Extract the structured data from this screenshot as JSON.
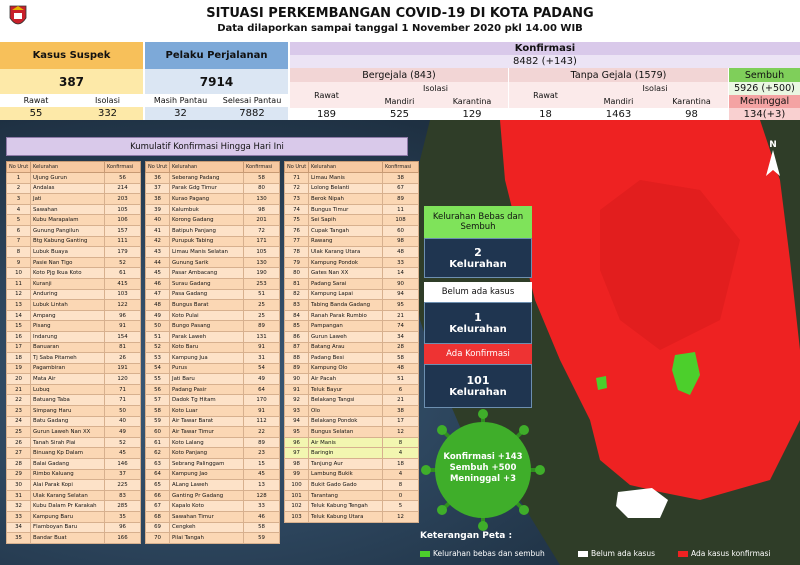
{
  "header": {
    "title": "SITUASI PERKEMBANGAN COVID-19 DI KOTA PADANG",
    "subtitle": "Data dilaporkan sampai tanggal 1 November 2020 pkl 14.00 WIB"
  },
  "suspek": {
    "title": "Kasus Suspek",
    "total": "387",
    "rawat_label": "Rawat",
    "rawat": "55",
    "isolasi_label": "Isolasi",
    "isolasi": "332"
  },
  "perjalanan": {
    "title": "Pelaku Perjalanan",
    "total": "7914",
    "pantau_label": "Masih Pantau",
    "pantau": "32",
    "selesai_label": "Selesai Pantau",
    "selesai": "7882"
  },
  "konfirmasi": {
    "title": "Konfirmasi",
    "total": "8482 (+143)",
    "bergejala": {
      "title": "Bergejala (843)",
      "rawat_label": "Rawat",
      "rawat": "189",
      "isolasi_label": "Isolasi",
      "mandiri_label": "Mandiri",
      "mandiri": "525",
      "karantina_label": "Karantina",
      "karantina": "129"
    },
    "tanpa": {
      "title": "Tanpa Gejala (1579)",
      "rawat_label": "Rawat",
      "rawat": "18",
      "isolasi_label": "Isolasi",
      "mandiri_label": "Mandiri",
      "mandiri": "1463",
      "karantina_label": "Karantina",
      "karantina": "98"
    },
    "sembuh_label": "Sembuh",
    "sembuh": "5926 (+500)",
    "meninggal_label": "Meninggal",
    "meninggal": "134(+3)"
  },
  "kumulatif": {
    "title": "Kumulatif Konfirmasi Hingga Hari Ini",
    "col_no": "No Urut",
    "col_kel": "Kelurahan",
    "col_konf": "Konfirmasi"
  },
  "table1": [
    [
      "1",
      "Ujung Gurun",
      "56"
    ],
    [
      "2",
      "Andalas",
      "214"
    ],
    [
      "3",
      "Jati",
      "203"
    ],
    [
      "4",
      "Sawahan",
      "105"
    ],
    [
      "5",
      "Kubu Marapalam",
      "106"
    ],
    [
      "6",
      "Gunung Pangilun",
      "157"
    ],
    [
      "7",
      "Btg Kabung Ganting",
      "111"
    ],
    [
      "8",
      "Lubuk Buaya",
      "179"
    ],
    [
      "9",
      "Pasie Nan Tigo",
      "52"
    ],
    [
      "10",
      "Koto Pjg Ikua Koto",
      "61"
    ],
    [
      "11",
      "Kuranji",
      "415"
    ],
    [
      "12",
      "Anduring",
      "103"
    ],
    [
      "13",
      "Lubuk Lintah",
      "122"
    ],
    [
      "14",
      "Ampang",
      "96"
    ],
    [
      "15",
      "Pisang",
      "91"
    ],
    [
      "16",
      "Indarung",
      "154"
    ],
    [
      "17",
      "Banuaran",
      "81"
    ],
    [
      "18",
      "Tj Saba Pitameh",
      "26"
    ],
    [
      "19",
      "Pagambiran",
      "191"
    ],
    [
      "20",
      "Mata Air",
      "120"
    ],
    [
      "21",
      "Lubuq",
      "71"
    ],
    [
      "22",
      "Batuang Taba",
      "71"
    ],
    [
      "23",
      "Simpang Haru",
      "50"
    ],
    [
      "24",
      "Batu Gadang",
      "40"
    ],
    [
      "25",
      "Gurun Laweh Nan XX",
      "49"
    ],
    [
      "26",
      "Tanah Sirah Piai",
      "52"
    ],
    [
      "27",
      "Binuang Kp Dalam",
      "45"
    ],
    [
      "28",
      "Balai Gadang",
      "146"
    ],
    [
      "29",
      "Rimbo Kaluang",
      "37"
    ],
    [
      "30",
      "Alai Parak Kopi",
      "225"
    ],
    [
      "31",
      "Ulak Karang Selatan",
      "83"
    ],
    [
      "32",
      "Kubu Dalam Pr Karakah",
      "285"
    ],
    [
      "33",
      "Kampung Baru",
      "35"
    ],
    [
      "34",
      "Flamboyan Baru",
      "96"
    ],
    [
      "35",
      "Bandar Buat",
      "166"
    ]
  ],
  "table2": [
    [
      "36",
      "Seberang Padang",
      "58"
    ],
    [
      "37",
      "Parak Gdg Timur",
      "80"
    ],
    [
      "38",
      "Kurao Pagang",
      "130"
    ],
    [
      "39",
      "Kalumbuk",
      "98"
    ],
    [
      "40",
      "Korong Gadang",
      "201"
    ],
    [
      "41",
      "Batipuh Panjang",
      "72"
    ],
    [
      "42",
      "Purupuk Tabing",
      "171"
    ],
    [
      "43",
      "Limau Manis Selatan",
      "105"
    ],
    [
      "44",
      "Gunung Sarik",
      "130"
    ],
    [
      "45",
      "Pasar Ambacang",
      "190"
    ],
    [
      "46",
      "Surau Gadang",
      "253"
    ],
    [
      "47",
      "Pasa Gadang",
      "51"
    ],
    [
      "48",
      "Bungus Barat",
      "25"
    ],
    [
      "49",
      "Koto Pulai",
      "25"
    ],
    [
      "50",
      "Bungo Pasang",
      "89"
    ],
    [
      "51",
      "Parak Laweh",
      "131"
    ],
    [
      "52",
      "Koto Baru",
      "91"
    ],
    [
      "53",
      "Kampung Jua",
      "31"
    ],
    [
      "54",
      "Purus",
      "54"
    ],
    [
      "55",
      "Jati Baru",
      "49"
    ],
    [
      "56",
      "Padang Pasir",
      "64"
    ],
    [
      "57",
      "Dadok Tg Hitam",
      "170"
    ],
    [
      "58",
      "Koto Luar",
      "91"
    ],
    [
      "59",
      "Air Tawar Barat",
      "112"
    ],
    [
      "60",
      "Air Tawar Timur",
      "22"
    ],
    [
      "61",
      "Koto Lalang",
      "89"
    ],
    [
      "62",
      "Koto Panjang",
      "23"
    ],
    [
      "63",
      "Sebrang Palinggam",
      "15"
    ],
    [
      "64",
      "Kampung Jao",
      "45"
    ],
    [
      "65",
      "ALang Laweh",
      "13"
    ],
    [
      "66",
      "Ganting Pr Gadang",
      "128"
    ],
    [
      "67",
      "Kapalo Koto",
      "33"
    ],
    [
      "68",
      "Sawahan Timur",
      "46"
    ],
    [
      "69",
      "Cengkeh",
      "58"
    ],
    [
      "70",
      "Pilai Tangah",
      "59"
    ]
  ],
  "table3": [
    [
      "71",
      "Limau Manis",
      "38"
    ],
    [
      "72",
      "Lolong Belanti",
      "67"
    ],
    [
      "73",
      "Berok Nipah",
      "89"
    ],
    [
      "74",
      "Bungus Timur",
      "11"
    ],
    [
      "75",
      "Sei Sapih",
      "108"
    ],
    [
      "76",
      "Cupak Tangah",
      "60"
    ],
    [
      "77",
      "Rawang",
      "98"
    ],
    [
      "78",
      "Ulak Karang Utara",
      "48"
    ],
    [
      "79",
      "Kampung Pondok",
      "33"
    ],
    [
      "80",
      "Gates Nan XX",
      "14"
    ],
    [
      "81",
      "Padang Sarai",
      "90"
    ],
    [
      "82",
      "Kampung Lapai",
      "94"
    ],
    [
      "83",
      "Tabing Banda Gadang",
      "95"
    ],
    [
      "84",
      "Ranah Parak Rumbio",
      "21"
    ],
    [
      "85",
      "Pampangan",
      "74"
    ],
    [
      "86",
      "Gurun Laweh",
      "34"
    ],
    [
      "87",
      "Batang Arau",
      "28"
    ],
    [
      "88",
      "Padang Besi",
      "58"
    ],
    [
      "89",
      "Kampung Olo",
      "48"
    ],
    [
      "90",
      "Air Pacah",
      "51"
    ],
    [
      "91",
      "Teluk Bayur",
      "6"
    ],
    [
      "92",
      "Belakang Tangsi",
      "21"
    ],
    [
      "93",
      "Olo",
      "38"
    ],
    [
      "94",
      "Belakang Pondok",
      "17"
    ],
    [
      "95",
      "Bungus Selatan",
      "12"
    ],
    [
      "96",
      "Air Manis",
      "8"
    ],
    [
      "97",
      "Baringin",
      "4"
    ],
    [
      "98",
      "Tanjung Aur",
      "18"
    ],
    [
      "99",
      "Lambung Bukik",
      "4"
    ],
    [
      "100",
      "Bukit Gado Gado",
      "8"
    ],
    [
      "101",
      "Tarantang",
      "0"
    ],
    [
      "102",
      "Teluk Kabung Tengah",
      "5"
    ],
    [
      "103",
      "Teluk Kabung Utara",
      "12"
    ]
  ],
  "side": {
    "bebas_title": "Kelurahan Bebas dan Sembuh",
    "bebas_count": "2",
    "bebas_unit": "Kelurahan",
    "belum_title": "Belum ada kasus",
    "belum_count": "1",
    "belum_unit": "Kelurahan",
    "ada_title": "Ada Konfirmasi",
    "ada_count": "101",
    "ada_unit": "Kelurahan"
  },
  "virus": {
    "line1": "Konfirmasi +143",
    "line2": "Sembuh +500",
    "line3": "Meninggal +3"
  },
  "legend": {
    "title": "Keterangan Peta :",
    "green": "Kelurahan bebas dan sembuh",
    "white": "Belum ada kasus",
    "red": "Ada kasus konfirmasi"
  },
  "compass": "N",
  "colors": {
    "suspek": "#f7c05a",
    "suspek_num": "#fde9a8",
    "perjalanan": "#7da9d8",
    "perjalanan_num": "#dbe6f3",
    "konfirmasi": "#d9c9ea",
    "sembuh": "#7fcf5a",
    "meninggal": "#f4a3a3",
    "map_red": "#ee2222",
    "map_green": "#4ccf2c"
  }
}
